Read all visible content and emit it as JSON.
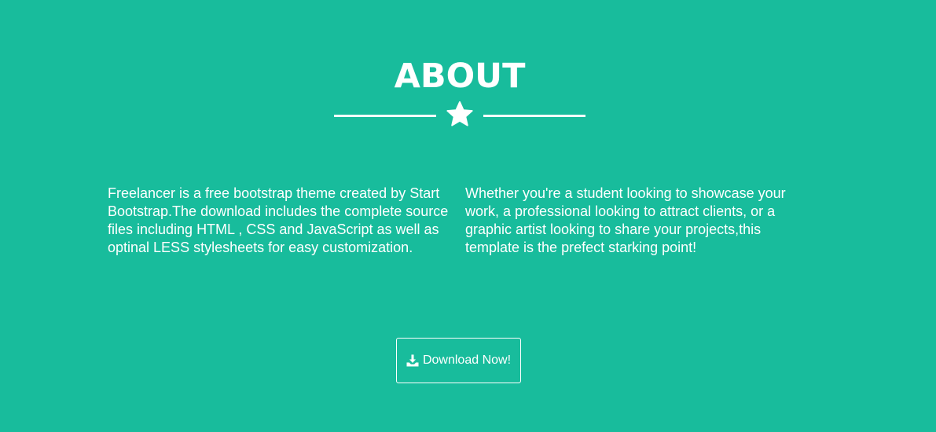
{
  "about": {
    "title": "ABOUT",
    "divider_icon": "star-icon",
    "left_paragraph": "Freelancer is a free bootstrap theme created by Start Bootstrap.The download includes the complete source files including HTML , CSS and JavaScript as well as optinal LESS stylesheets for easy customization.",
    "right_paragraph": "Whether you're a student looking to showcase your work, a professional looking to attract clients, or a graphic artist looking to share your projects,this template is the prefect starking point!",
    "download_button": {
      "label": "Download Now!",
      "icon": "download-icon"
    }
  },
  "colors": {
    "background": "#18bc9c",
    "text": "#ffffff"
  }
}
